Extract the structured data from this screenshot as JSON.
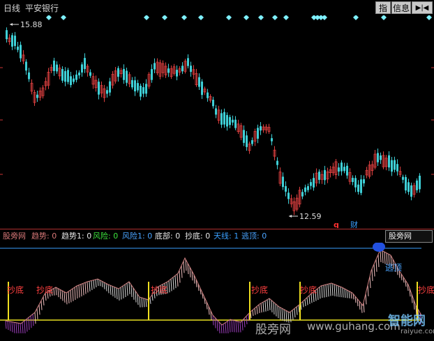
{
  "header": {
    "period": "日线",
    "stock_name": "平安银行",
    "btn_index": "指",
    "btn_info": "信息",
    "btn_arrow": "▶|◀"
  },
  "main_chart": {
    "high_label": "15.88",
    "low_label": "12.59",
    "marker_q": "q",
    "marker_cai": "财"
  },
  "indicator": {
    "name": "股旁网",
    "trend": "趋势: 0",
    "trend1": "趋势1: 0",
    "risk": "风险: 0",
    "risk1": "风险1: 0",
    "bottom": "底部: 0",
    "chaodi": "抄底: 0",
    "tianxian": "天线: 1",
    "taoding": "逃顶: 0",
    "dropdown": "股旁网",
    "labels": {
      "chaodi": "抄底",
      "taoding": "逃顶"
    },
    "colors": {
      "name": "#d77878",
      "trend": "#d77878",
      "trend1": "#e8e8e8",
      "risk": "#3ce33c",
      "risk1": "#4aa4ff",
      "bottom": "#e8e8e8",
      "chaodi": "#e8e8e8",
      "tianxian": "#3aa0ff",
      "taoding": "#4aa4ff"
    }
  },
  "watermark": {
    "text1": "股旁网",
    "text2": "www.guhang.com",
    "logo_text": "智能网",
    "logo_sub": "raiyue.com"
  }
}
